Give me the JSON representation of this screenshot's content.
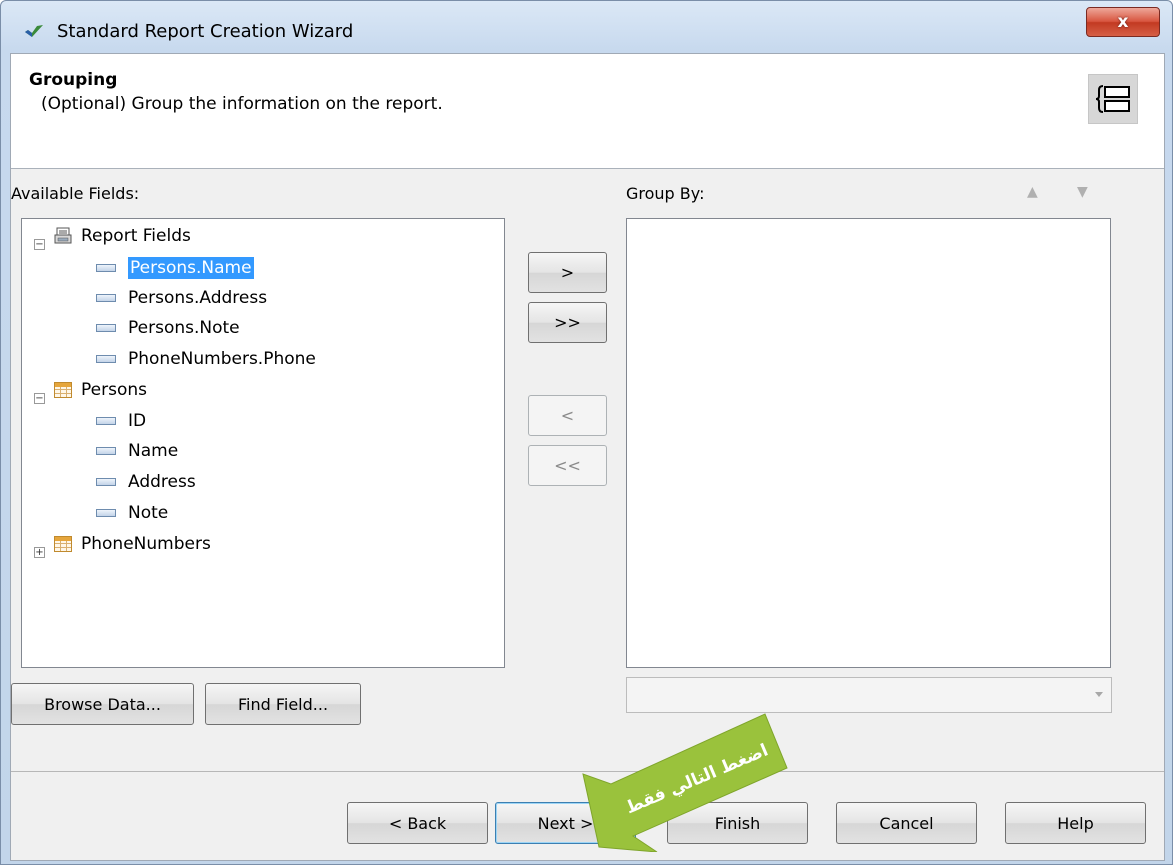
{
  "window": {
    "title": "Standard Report Creation Wizard",
    "close_label": "x"
  },
  "header": {
    "title": "Grouping",
    "description": "(Optional) Group the information on the report."
  },
  "left_panel": {
    "label": "Available Fields:",
    "tree": [
      {
        "label": "Report Fields",
        "type": "report",
        "expanded": true,
        "children": [
          "Persons.Name",
          "Persons.Address",
          "Persons.Note",
          "PhoneNumbers.Phone"
        ],
        "selected": "Persons.Name"
      },
      {
        "label": "Persons",
        "type": "table",
        "expanded": true,
        "children": [
          "ID",
          "Name",
          "Address",
          "Note"
        ]
      },
      {
        "label": "PhoneNumbers",
        "type": "table",
        "expanded": false,
        "children": []
      }
    ]
  },
  "transfer_buttons": {
    "add": ">",
    "add_all": ">>",
    "remove": "<",
    "remove_all": "<<"
  },
  "right_panel": {
    "label": "Group By:"
  },
  "lower_buttons": {
    "browse": "Browse Data...",
    "find": "Find Field..."
  },
  "callout": {
    "text": "اضغط التالي فقط",
    "color": "#9ac23c"
  },
  "footer": {
    "back": "< Back",
    "next": "Next >",
    "finish": "Finish",
    "cancel": "Cancel",
    "help": "Help"
  }
}
